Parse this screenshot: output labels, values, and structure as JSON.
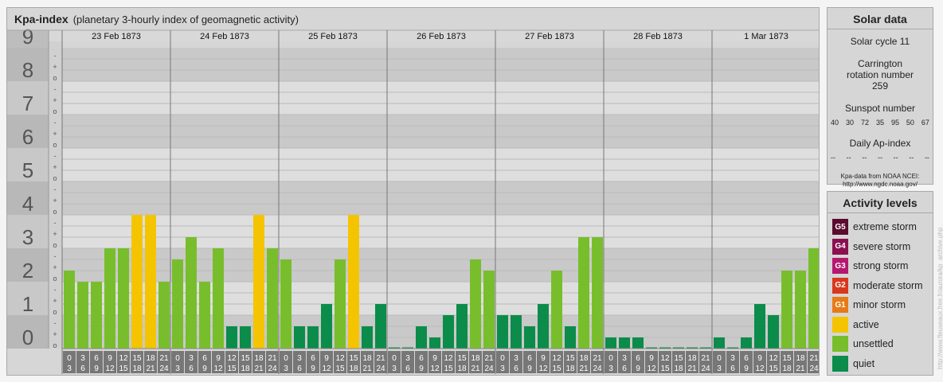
{
  "title": {
    "main": "Kpa-index",
    "sub": "(planetary 3-hourly index of geomagnetic activity)"
  },
  "chart_data": {
    "type": "bar",
    "ylim": [
      0,
      9
    ],
    "y_ticks": [
      "0",
      "1",
      "2",
      "3",
      "4",
      "5",
      "6",
      "7",
      "8",
      "9"
    ],
    "minor_marks": [
      "o",
      "+",
      "-"
    ],
    "days": [
      "23 Feb 1873",
      "24 Feb 1873",
      "25 Feb 1873",
      "26 Feb 1873",
      "27 Feb 1873",
      "28 Feb 1873",
      "1 Mar 1873"
    ],
    "hour_labels": [
      [
        "0",
        "3"
      ],
      [
        "3",
        "6"
      ],
      [
        "6",
        "9"
      ],
      [
        "9",
        "12"
      ],
      [
        "12",
        "15"
      ],
      [
        "15",
        "18"
      ],
      [
        "18",
        "21"
      ],
      [
        "21",
        "24"
      ]
    ],
    "values": [
      [
        2.333,
        2.0,
        2.0,
        3.0,
        3.0,
        4.0,
        4.0,
        2.0
      ],
      [
        2.667,
        3.333,
        2.0,
        3.0,
        0.667,
        0.667,
        4.0,
        3.0
      ],
      [
        2.667,
        0.667,
        0.667,
        1.333,
        2.667,
        4.0,
        0.667,
        1.333
      ],
      [
        0.0,
        0.0,
        0.667,
        0.333,
        1.0,
        1.333,
        2.667,
        2.333
      ],
      [
        1.0,
        1.0,
        0.667,
        1.333,
        2.333,
        0.667,
        3.333,
        3.333
      ],
      [
        0.333,
        0.333,
        0.333,
        0.0,
        0.0,
        0.0,
        0.0,
        0.0
      ],
      [
        0.333,
        0.0,
        0.333,
        1.333,
        1.0,
        2.333,
        2.333,
        3.0
      ]
    ],
    "colors": {
      "quiet": "#0c8c4a",
      "unsettled": "#78be2c",
      "active": "#f5c400"
    }
  },
  "solar": {
    "title": "Solar data",
    "cycle": "Solar cycle 11",
    "carrington": "Carrington rotation number 259",
    "ssn_label": "Sunspot number",
    "ssn": [
      "40",
      "30",
      "72",
      "35",
      "95",
      "50",
      "67"
    ],
    "ap_label": "Daily Ap-index",
    "ap": [
      "--",
      "--",
      "--",
      "--",
      "--",
      "--",
      "--"
    ],
    "credit1": "Kpa-data from NOAA NCEI:",
    "credit2": "http://www.ngdc.noaa.gov/"
  },
  "levels": {
    "title": "Activity levels",
    "items": [
      {
        "code": "G5",
        "label": "extreme storm",
        "color": "#5a0b2e"
      },
      {
        "code": "G4",
        "label": "severe storm",
        "color": "#8a1050"
      },
      {
        "code": "G3",
        "label": "strong storm",
        "color": "#b5186e"
      },
      {
        "code": "G2",
        "label": "moderate storm",
        "color": "#d8381e"
      },
      {
        "code": "G1",
        "label": "minor storm",
        "color": "#e87a16"
      },
      {
        "code": "",
        "label": "active",
        "color": "#f5c400"
      },
      {
        "code": "",
        "label": "unsettled",
        "color": "#78be2c"
      },
      {
        "code": "",
        "label": "quiet",
        "color": "#0c8c4a"
      }
    ]
  },
  "watermark": "http://www.fleuseaux.free.fr/aurora/kp_archive.php"
}
